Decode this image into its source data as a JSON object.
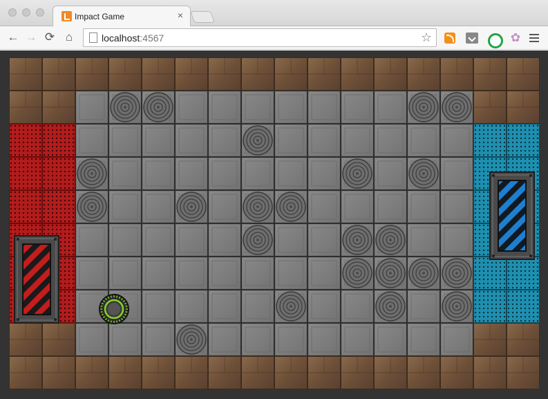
{
  "browser": {
    "tab_title": "Impact Game",
    "tab_close": "×",
    "url_host": "localhost",
    "url_port": ":4567",
    "back_glyph": "←",
    "forward_glyph": "→",
    "reload_glyph": "⟳",
    "home_glyph": "⌂",
    "star_glyph": "☆",
    "extensions": [
      "rss-icon",
      "pocket-icon",
      "green-extension-icon",
      "bunny-extension-icon"
    ]
  },
  "game": {
    "grid": {
      "cols": 16,
      "rows": 10,
      "map": [
        "WWWWWWWWWWWWWWWW",
        "WWFCCFFFFFFFCCWW",
        "RRFFFFFCFFFFFFBB",
        "RRCFFFFFFFCFCFBB",
        "RRCFFCFCCFFFFFBB",
        "RRFFFFFCFFCCFFBB",
        "RRFFFFFFFFCCCCBB",
        "RRFFFFFFCFFCFCBB",
        "WWFFFCFFFFFFFFWW",
        "WWWWWWWWWWWWWWWW"
      ]
    },
    "tile_colors": {
      "wall": "#7a5a3e",
      "floor": "#7f7f7f",
      "circle_floor": "#6f6f6f",
      "red_team": "#b21c1c",
      "blue_team": "#1f8fb0",
      "player_ring": "#8ad12a"
    },
    "red_goal": {
      "stripe_color": "#c31d1d"
    },
    "blue_goal": {
      "stripe_color": "#1e7fd0"
    },
    "player": {
      "name": "player-disc"
    }
  }
}
